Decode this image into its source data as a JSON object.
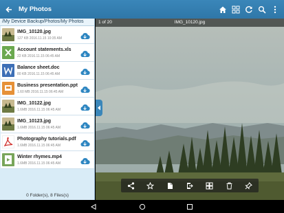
{
  "appbar": {
    "title": "My Photos"
  },
  "sidebar": {
    "path": "/My Device Backup/Photos/My Photos",
    "files": [
      {
        "name": "IMG_10120.jpg",
        "meta": "127 KB  2016.11.15  10:35 AM",
        "icon": "image-thumb-icon",
        "kind": "image"
      },
      {
        "name": "Account statements.xls",
        "meta": "22 KB  2016.11.15  06:45 AM",
        "icon": "excel-file-icon",
        "kind": "xls"
      },
      {
        "name": "Balance sheet.doc",
        "meta": "80 KB  2016.11.15  06:45 AM",
        "icon": "word-file-icon",
        "kind": "doc"
      },
      {
        "name": "Business presentation.ppt",
        "meta": "1.60 MB  2016.11.15  06:45 AM",
        "icon": "powerpoint-file-icon",
        "kind": "ppt"
      },
      {
        "name": "IMG_10122.jpg",
        "meta": "1.6MB  2016.11.15  06:45 AM",
        "icon": "image-thumb-icon",
        "kind": "image"
      },
      {
        "name": "IMG_10123.jpg",
        "meta": "1.6MB  2016.11.15  06:45 AM",
        "icon": "image-thumb-icon",
        "kind": "image"
      },
      {
        "name": "Photography tutorials.pdf",
        "meta": "1.6MB  2016.11.15  06:45 AM",
        "icon": "pdf-file-icon",
        "kind": "pdf"
      },
      {
        "name": "Winter rhymes.mp4",
        "meta": "1.6MB  2016.11.15  06:45 AM",
        "icon": "video-file-icon",
        "kind": "mp4"
      }
    ],
    "footer": "0 Folder(s), 8 Files(s)"
  },
  "viewer": {
    "counter": "1 of 20",
    "filename": "IMG_10120.jpg"
  },
  "colors": {
    "appbar": "#3a86b9",
    "sidebar": "#d9ecf7",
    "download": "#2e86c1"
  }
}
